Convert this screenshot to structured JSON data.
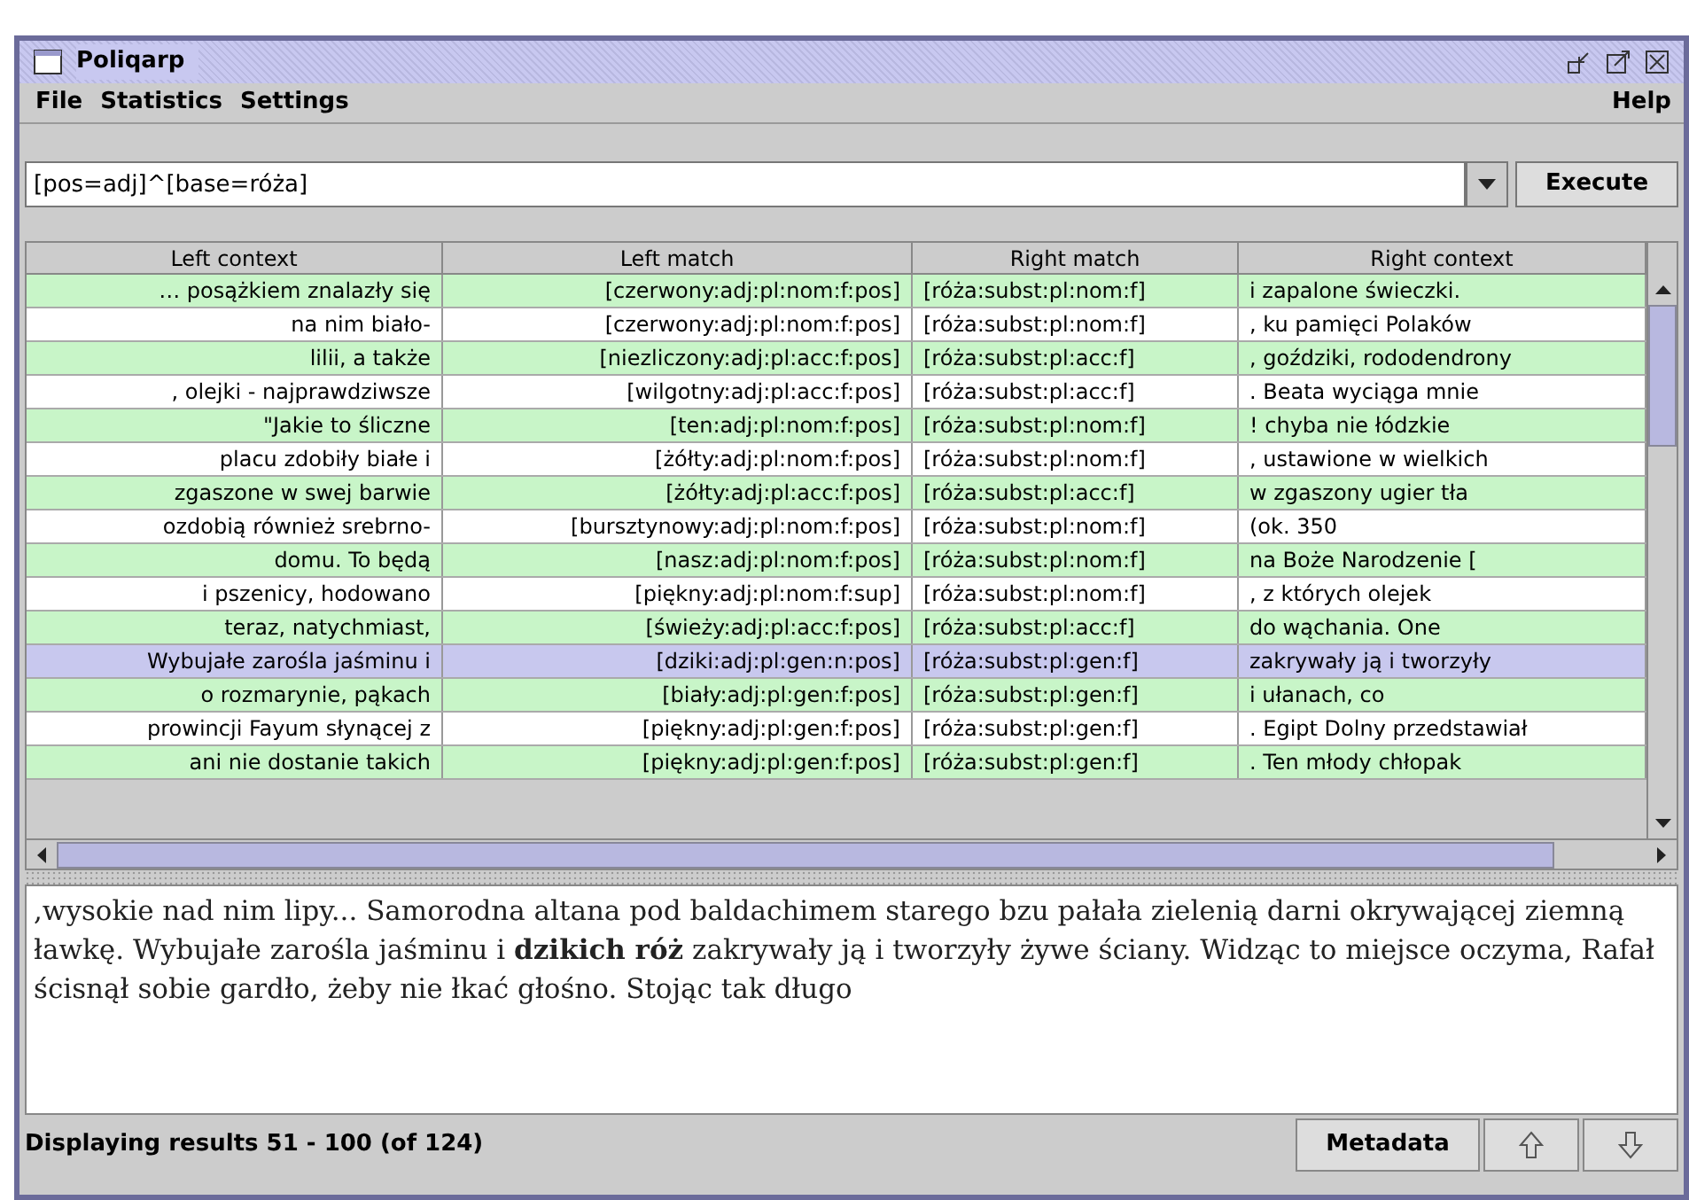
{
  "window": {
    "title": "Poliqarp"
  },
  "menu": {
    "left": [
      "File",
      "Statistics",
      "Settings"
    ],
    "right": [
      "Help"
    ]
  },
  "query": {
    "value": "[pos=adj]^[base=róża]",
    "button": "Execute"
  },
  "table": {
    "columns": [
      "Left context",
      "Left match",
      "Right match",
      "Right context"
    ],
    "rows": [
      {
        "cells": [
          "… posążkiem znalazły się",
          "[czerwony:adj:pl:nom:f:pos]",
          "[róża:subst:pl:nom:f]",
          "i zapalone świeczki."
        ],
        "selected": false
      },
      {
        "cells": [
          "na nim biało-",
          "[czerwony:adj:pl:nom:f:pos]",
          "[róża:subst:pl:nom:f]",
          ", ku pamięci Polaków"
        ],
        "selected": false
      },
      {
        "cells": [
          "lilii, a także",
          "[niezliczony:adj:pl:acc:f:pos]",
          "[róża:subst:pl:acc:f]",
          ", goździki, rododendrony"
        ],
        "selected": false
      },
      {
        "cells": [
          ", olejki - najprawdziwsze",
          "[wilgotny:adj:pl:acc:f:pos]",
          "[róża:subst:pl:acc:f]",
          ". Beata wyciąga mnie"
        ],
        "selected": false
      },
      {
        "cells": [
          "\"Jakie to śliczne",
          "[ten:adj:pl:nom:f:pos]",
          "[róża:subst:pl:nom:f]",
          "! chyba nie łódzkie"
        ],
        "selected": false
      },
      {
        "cells": [
          "placu zdobiły białe i",
          "[żółty:adj:pl:nom:f:pos]",
          "[róża:subst:pl:nom:f]",
          ", ustawione w wielkich"
        ],
        "selected": false
      },
      {
        "cells": [
          "zgaszone w swej barwie",
          "[żółty:adj:pl:acc:f:pos]",
          "[róża:subst:pl:acc:f]",
          "w zgaszony ugier tła"
        ],
        "selected": false
      },
      {
        "cells": [
          "ozdobią również srebrno-",
          "[bursztynowy:adj:pl:nom:f:pos]",
          "[róża:subst:pl:nom:f]",
          "(ok. 350"
        ],
        "selected": false
      },
      {
        "cells": [
          "domu. To będą",
          "[nasz:adj:pl:nom:f:pos]",
          "[róża:subst:pl:nom:f]",
          "na Boże Narodzenie ["
        ],
        "selected": false
      },
      {
        "cells": [
          "i pszenicy, hodowano",
          "[piękny:adj:pl:nom:f:sup]",
          "[róża:subst:pl:nom:f]",
          ", z których olejek"
        ],
        "selected": false
      },
      {
        "cells": [
          "teraz, natychmiast,",
          "[świeży:adj:pl:acc:f:pos]",
          "[róża:subst:pl:acc:f]",
          "do wąchania. One"
        ],
        "selected": false
      },
      {
        "cells": [
          "Wybujałe zarośla jaśminu i",
          "[dziki:adj:pl:gen:n:pos]",
          "[róża:subst:pl:gen:f]",
          "zakrywały ją i tworzyły"
        ],
        "selected": true
      },
      {
        "cells": [
          "o rozmarynie, pąkach",
          "[biały:adj:pl:gen:f:pos]",
          "[róża:subst:pl:gen:f]",
          "i ułanach, co"
        ],
        "selected": false
      },
      {
        "cells": [
          "prowincji Fayum słynącej z",
          "[piękny:adj:pl:gen:f:pos]",
          "[róża:subst:pl:gen:f]",
          ". Egipt Dolny przedstawiał"
        ],
        "selected": false
      },
      {
        "cells": [
          "ani nie dostanie takich",
          "[piękny:adj:pl:gen:f:pos]",
          "[róża:subst:pl:gen:f]",
          ". Ten młody chłopak"
        ],
        "selected": false
      }
    ]
  },
  "context": {
    "text": ",wysokie nad nim lipy... Samorodna altana pod baldachimem starego bzu pałała zielenią darni okrywającej ziemną ławkę. Wybujałe zarośla jaśminu i **dzikich róż** zakrywały ją i tworzyły żywe ściany. Widząc to miejsce oczyma, Rafał ścisnął sobie gardło, żeby nie łkać głośno. Stojąc tak długo"
  },
  "status_bar": {
    "text": "Displaying results 51 - 100 (of 124)",
    "button": "Metadata"
  }
}
